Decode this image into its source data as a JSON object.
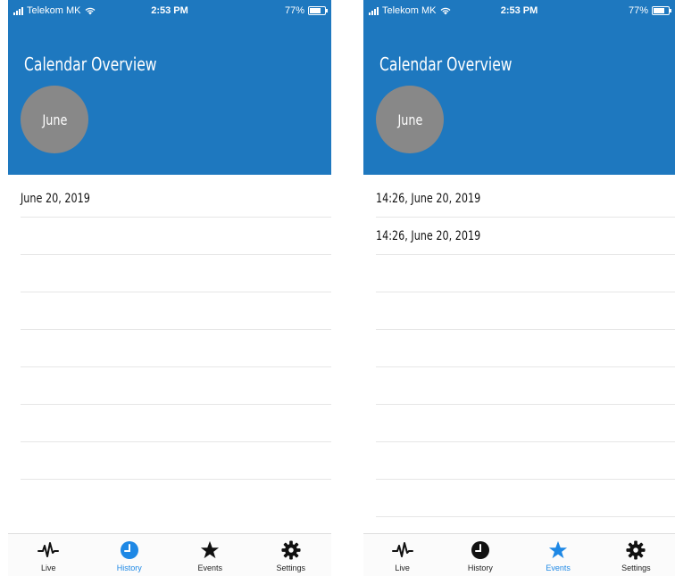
{
  "colors": {
    "header": "#1e78bf",
    "month_circle": "#888888",
    "active_tab": "#1e88e5",
    "inactive_tab": "#111111"
  },
  "screens": [
    {
      "status": {
        "carrier": "Telekom MK",
        "time": "2:53 PM",
        "battery": "77%",
        "battery_level": 77
      },
      "title": "Calendar Overview",
      "month": "June",
      "rows": [
        "June 20, 2019",
        "",
        "",
        "",
        "",
        "",
        "",
        "",
        ""
      ],
      "tabs": [
        {
          "label": "Live",
          "icon": "pulse-icon",
          "active": false
        },
        {
          "label": "History",
          "icon": "clock-icon",
          "active": true
        },
        {
          "label": "Events",
          "icon": "star-icon",
          "active": false
        },
        {
          "label": "Settings",
          "icon": "gear-icon",
          "active": false
        }
      ]
    },
    {
      "status": {
        "carrier": "Telekom MK",
        "time": "2:53 PM",
        "battery": "77%",
        "battery_level": 77
      },
      "title": "Calendar Overview",
      "month": "June",
      "rows": [
        "14:26, June 20, 2019",
        "14:26, June 20, 2019",
        "",
        "",
        "",
        "",
        "",
        "",
        ""
      ],
      "tabs": [
        {
          "label": "Live",
          "icon": "pulse-icon",
          "active": false
        },
        {
          "label": "History",
          "icon": "clock-icon",
          "active": false
        },
        {
          "label": "Events",
          "icon": "star-icon",
          "active": true
        },
        {
          "label": "Settings",
          "icon": "gear-icon",
          "active": false
        }
      ]
    }
  ]
}
